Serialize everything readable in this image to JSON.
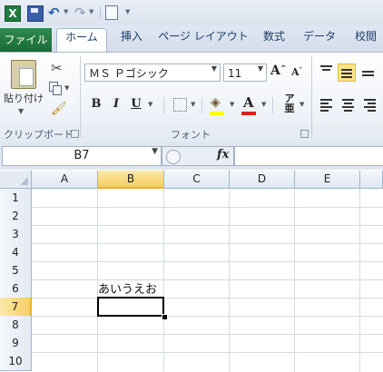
{
  "tabs": {
    "file": "ファイル",
    "items": [
      "ホーム",
      "挿入",
      "ページ レイアウト",
      "数式",
      "データ",
      "校閲"
    ]
  },
  "clipboard": {
    "paste_label": "貼り付け",
    "group_label": "クリップボード"
  },
  "font": {
    "name": "ＭＳ Ｐゴシック",
    "size": "11",
    "grow_label": "A",
    "shrink_label": "A",
    "bold": "B",
    "italic": "I",
    "underline": "U",
    "font_color_label": "A",
    "furigana_label": "ア亜",
    "group_label": "フォント"
  },
  "formula_bar": {
    "name_box": "B7",
    "fx_label": "fx",
    "value": ""
  },
  "grid": {
    "columns": [
      "A",
      "B",
      "C",
      "D",
      "E"
    ],
    "rows": [
      "1",
      "2",
      "3",
      "4",
      "5",
      "6",
      "7",
      "8",
      "9",
      "10"
    ],
    "selected_column": "B",
    "selected_row": "7",
    "cell_B6": "あいうえお"
  },
  "colors": {
    "file_tab": "#1f7a3e",
    "selection_header": "#f5cf62",
    "fill_color": "#ffff00",
    "font_color": "#e02020"
  }
}
